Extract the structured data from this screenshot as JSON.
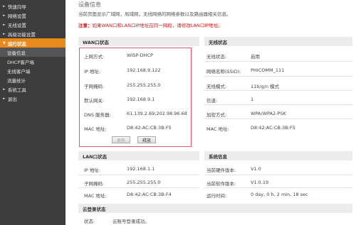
{
  "sidebar": {
    "items_top": [
      {
        "label": "快速向导"
      },
      {
        "label": "网络设置"
      },
      {
        "label": "无线设置"
      },
      {
        "label": "高级功能设置"
      }
    ],
    "active_item": {
      "label": "运行状态"
    },
    "sub_items": [
      {
        "label": "设备信息"
      },
      {
        "label": "DHCP客户端"
      },
      {
        "label": "无线客户端"
      },
      {
        "label": "流量统计"
      }
    ],
    "items_bottom": [
      {
        "label": "系统工具"
      },
      {
        "label": "退出"
      }
    ]
  },
  "main": {
    "title": "设备信息",
    "description": "当前页面显示广域网，局域网，无线网络的网络参数以及路由器相关信息。",
    "note_prefix": "注意：",
    "note_text": "如果WAN口和LAN口IP地址在同一网段，请修改LAN口IP地址。"
  },
  "wan": {
    "header": "WAN口状态",
    "rows": [
      {
        "label": "上网方式:",
        "value": "WISP-DHCP"
      },
      {
        "label": "IP 地址:",
        "value": "192.168.9.122"
      },
      {
        "label": "子网掩码:",
        "value": "255.255.255.0"
      },
      {
        "label": "默认网关:",
        "value": "192.168.9.1"
      },
      {
        "label": "DNS 服务器:",
        "value": "61.139.2.69;202.98.96.68"
      },
      {
        "label": "MAC 地址:",
        "value": "D8:42:AC:CB:3B:F5"
      }
    ],
    "button_renew": "更新",
    "button_release": "释放"
  },
  "wireless": {
    "header": "无线状态",
    "rows": [
      {
        "label": "无线状态:",
        "value": "启用"
      },
      {
        "label": "网络名称(SSID):",
        "value": "PHICOMM_111"
      },
      {
        "label": "无线模式:",
        "value": "11b/g/n 模式"
      },
      {
        "label": "信道:",
        "value": "1"
      },
      {
        "label": "加密方式:",
        "value": "WPA/WPA2-PSK"
      },
      {
        "label": "MAC 地址:",
        "value": "D8:42:AC:CB:3B:F5"
      }
    ]
  },
  "lan": {
    "header": "LAN口状态",
    "rows": [
      {
        "label": "IP 地址:",
        "value": "192.168.1.1"
      },
      {
        "label": "子网掩码:",
        "value": "255.255.255.0"
      },
      {
        "label": "MAC 地址:",
        "value": "D8:42:AC:CB:3B:F4"
      }
    ]
  },
  "system": {
    "header": "系统信息",
    "rows": [
      {
        "label": "当前硬件版本:",
        "value": "V1.0"
      },
      {
        "label": "当前软件版本:",
        "value": "V1.0.19"
      },
      {
        "label": "运行时间:",
        "value": "0 day, 0 h, 2 min, 18 sec"
      }
    ]
  },
  "cloud": {
    "header": "云登录状态",
    "label": "状态:",
    "value": "云账号登录成功。"
  },
  "colors": {
    "sidebar_bg": "#3c3c3c",
    "active_accent": "#e8891c",
    "note_red": "#d01818",
    "wan_box_border": "#e05a6a"
  }
}
